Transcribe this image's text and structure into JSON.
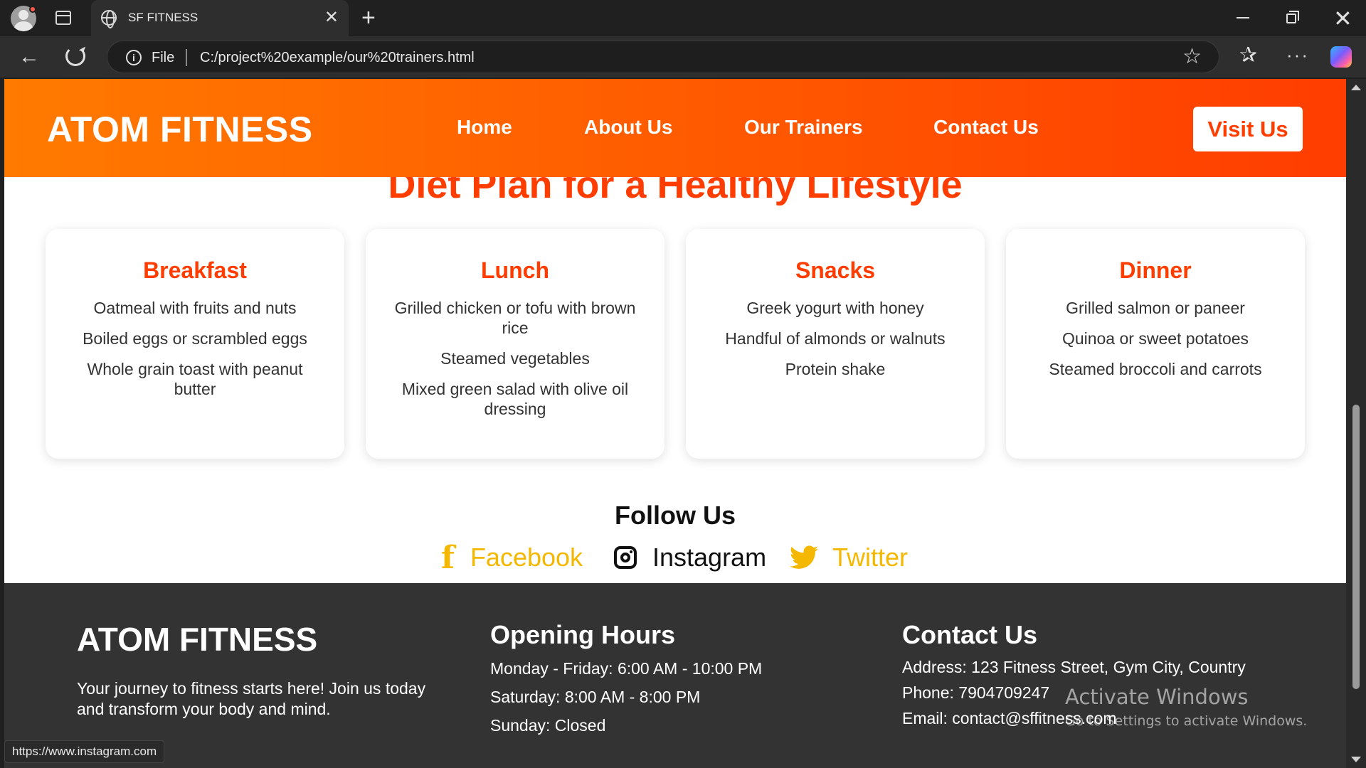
{
  "browser": {
    "tab_title": "SF FITNESS",
    "tab_close": "✕",
    "new_tab": "+",
    "url_scheme_label": "File",
    "url": "C:/project%20example/our%20trainers.html",
    "status_url": "https://www.instagram.com",
    "icons": [
      "profile-icon",
      "tab-actions-icon",
      "globe-icon",
      "back-icon",
      "reload-icon",
      "info-icon",
      "star-icon",
      "favorites-icon",
      "more-icon",
      "copilot-icon"
    ]
  },
  "navbar": {
    "logo": "ATOM FITNESS",
    "links": [
      "Home",
      "About Us",
      "Our Trainers",
      "Contact Us"
    ],
    "cta": "Visit Us"
  },
  "diet": {
    "title": "Diet Plan for a Healthy Lifestyle",
    "meals": [
      {
        "name": "Breakfast",
        "items": [
          "Oatmeal with fruits and nuts",
          "Boiled eggs or scrambled eggs",
          "Whole grain toast with peanut butter"
        ]
      },
      {
        "name": "Lunch",
        "items": [
          "Grilled chicken or tofu with brown rice",
          "Steamed vegetables",
          "Mixed green salad with olive oil dressing"
        ]
      },
      {
        "name": "Snacks",
        "items": [
          "Greek yogurt with honey",
          "Handful of almonds or walnuts",
          "Protein shake"
        ]
      },
      {
        "name": "Dinner",
        "items": [
          "Grilled salmon or paneer",
          "Quinoa or sweet potatoes",
          "Steamed broccoli and carrots"
        ]
      }
    ]
  },
  "follow": {
    "title": "Follow Us",
    "facebook": "Facebook",
    "instagram": "Instagram",
    "twitter": "Twitter"
  },
  "footer": {
    "brand": "ATOM FITNESS",
    "tagline": "Your journey to fitness starts here! Join us today and transform your body and mind.",
    "hours_title": "Opening Hours",
    "hours": [
      "Monday - Friday: 6:00 AM - 10:00 PM",
      "Saturday: 8:00 AM - 8:00 PM",
      "Sunday: Closed"
    ],
    "contact_title": "Contact Us",
    "contact": [
      "Address: 123 Fitness Street, Gym City, Country",
      "Phone: 7904709247",
      "Email: contact@sffitness.com"
    ]
  },
  "watermark": {
    "line1": "Activate Windows",
    "line2": "Go to Settings to activate Windows."
  },
  "colors": {
    "brand_orange": "#ff7a00",
    "brand_red": "#ff3d00",
    "social_yellow": "#f5b800",
    "footer_bg": "#333333"
  }
}
